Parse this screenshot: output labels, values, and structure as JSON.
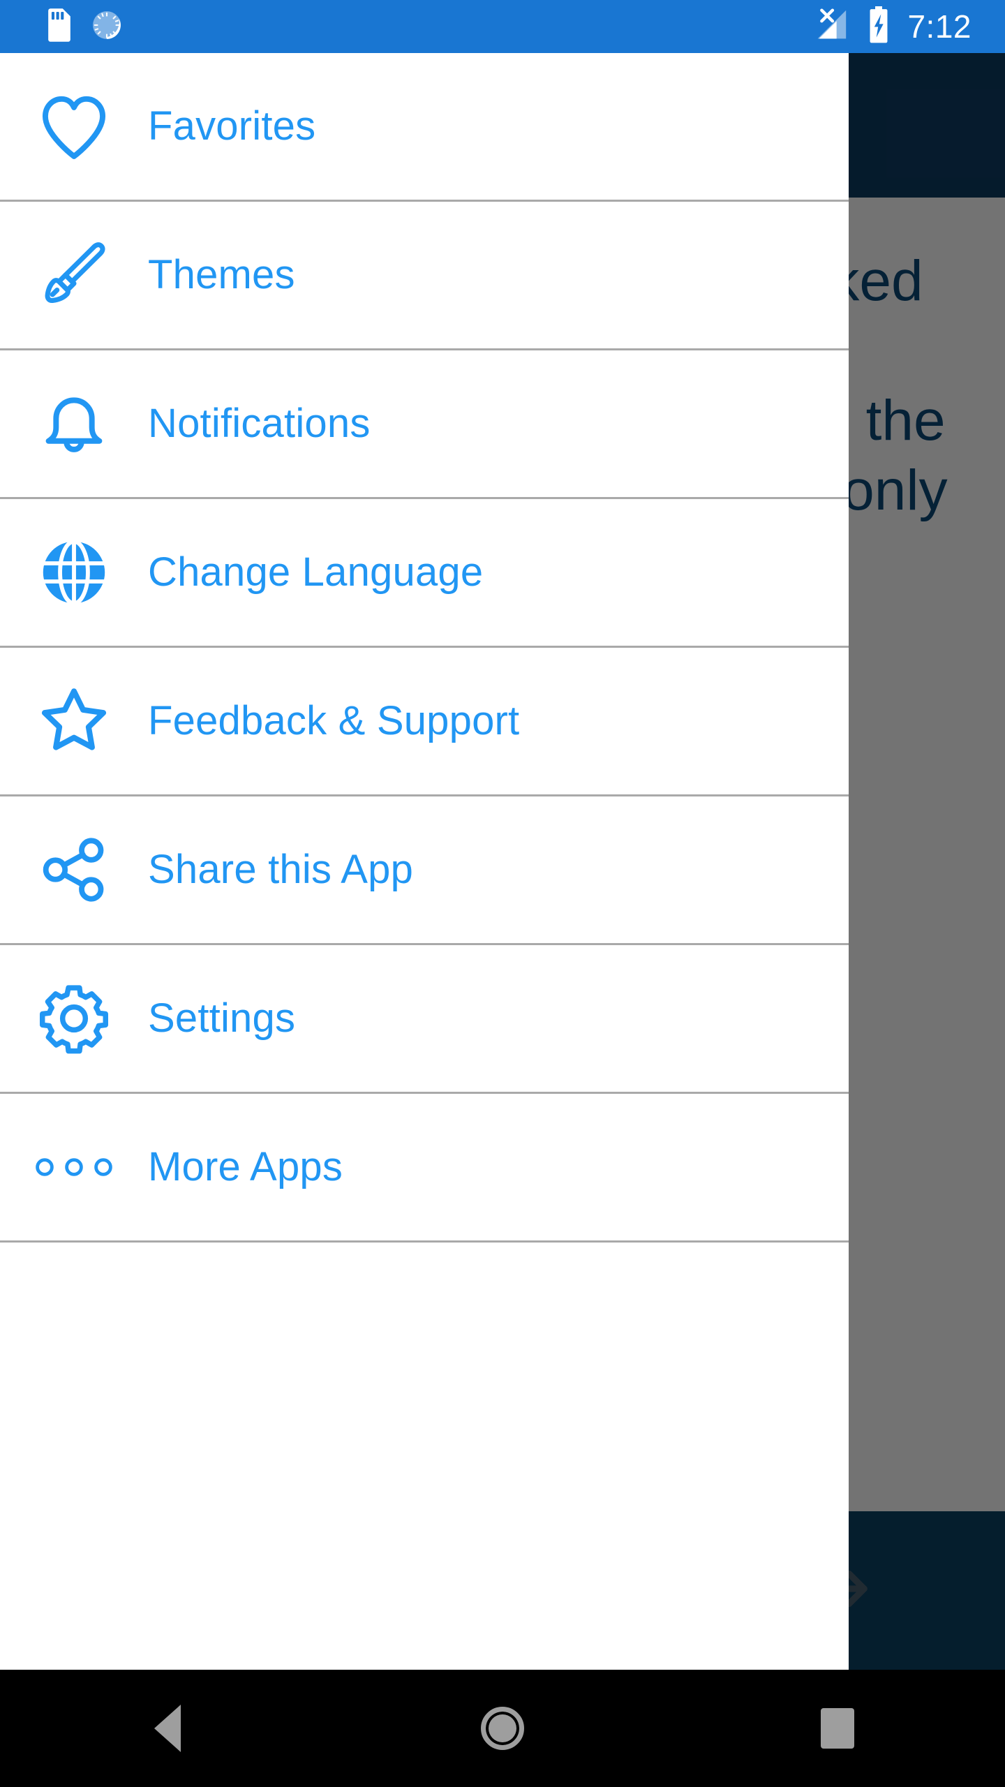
{
  "status_bar": {
    "time": "7:12",
    "icons": [
      "sim-card-icon",
      "loading-spinner-icon",
      "signal-no-sim-icon",
      "battery-charging-icon"
    ],
    "background_color": "#1976d2",
    "text_color": "#ffffff"
  },
  "drawer": {
    "accent_color": "#2196f3",
    "divider_color": "#a9a9a9",
    "background_color": "#ffffff",
    "items": [
      {
        "label": "Favorites",
        "icon": "heart-outline-icon"
      },
      {
        "label": "Themes",
        "icon": "paintbrush-icon"
      },
      {
        "label": "Notifications",
        "icon": "bell-outline-icon"
      },
      {
        "label": "Change Language",
        "icon": "globe-icon"
      },
      {
        "label": "Feedback & Support",
        "icon": "star-outline-icon"
      },
      {
        "label": "Share this App",
        "icon": "share-nodes-icon"
      },
      {
        "label": "Settings",
        "icon": "gear-outline-icon"
      },
      {
        "label": "More Apps",
        "icon": "three-circles-icon"
      }
    ]
  },
  "background_app": {
    "appbar_color": "#0d3c63",
    "bottombar_color": "#0d4365",
    "text_color": "#0d4a78",
    "content_text": "A rich man and a poor man walked down the road and never came back. One of them wanted gold, the other wanted to know why, and only the thoughtful gets the answer.",
    "next_icon": "arrow-right-icon"
  },
  "nav_bar": {
    "background_color": "#000000",
    "buttons": [
      {
        "name": "back",
        "icon": "triangle-left-icon"
      },
      {
        "name": "home",
        "icon": "circle-icon"
      },
      {
        "name": "recents",
        "icon": "square-icon"
      }
    ]
  }
}
